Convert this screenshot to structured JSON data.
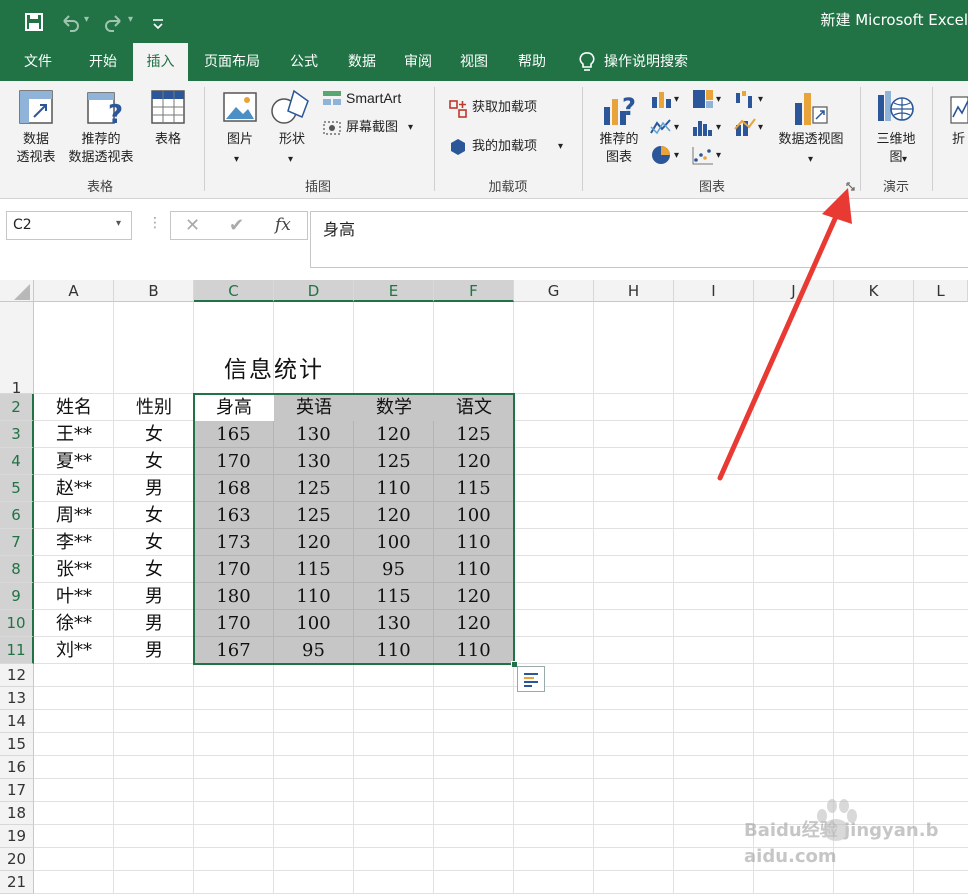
{
  "window": {
    "title": "新建 Microsoft Excel"
  },
  "menu": {
    "tabs": [
      "文件",
      "开始",
      "插入",
      "页面布局",
      "公式",
      "数据",
      "审阅",
      "视图",
      "帮助"
    ],
    "active_tab": "插入",
    "search_hint": "操作说明搜索"
  },
  "ribbon": {
    "groups": {
      "tables": "表格",
      "illustrations": "插图",
      "addins": "加载项",
      "charts": "图表",
      "tours": "演示"
    },
    "pivot_table": [
      "数据",
      "透视表"
    ],
    "recommended_pivot": [
      "推荐的",
      "数据透视表"
    ],
    "table": "表格",
    "picture": "图片",
    "shapes": "形状",
    "smartart": "SmartArt",
    "screenshot": "屏幕截图",
    "get_addins": "获取加载项",
    "my_addins": "我的加载项",
    "recommended_charts": [
      "推荐的",
      "图表"
    ],
    "pivot_chart": "数据透视图",
    "map_3d": [
      "三维地",
      "图"
    ],
    "line_partial": "折"
  },
  "formula_bar": {
    "name_box": "C2",
    "fx": "fx",
    "content": "身高"
  },
  "sheet": {
    "columns": [
      "A",
      "B",
      "C",
      "D",
      "E",
      "F",
      "G",
      "H",
      "I",
      "J",
      "K",
      "L"
    ],
    "rows": [
      "1",
      "2",
      "3",
      "4",
      "5",
      "6",
      "7",
      "8",
      "9",
      "10",
      "11",
      "12",
      "13",
      "14",
      "15",
      "16",
      "17",
      "18",
      "19",
      "20",
      "21"
    ],
    "title": "信息统计",
    "headers": [
      "姓名",
      "性别",
      "身高",
      "英语",
      "数学",
      "语文"
    ],
    "records": [
      [
        "王**",
        "女",
        "165",
        "130",
        "120",
        "125"
      ],
      [
        "夏**",
        "女",
        "170",
        "130",
        "125",
        "120"
      ],
      [
        "赵**",
        "男",
        "168",
        "125",
        "110",
        "115"
      ],
      [
        "周**",
        "女",
        "163",
        "125",
        "120",
        "100"
      ],
      [
        "李**",
        "女",
        "173",
        "120",
        "100",
        "110"
      ],
      [
        "张**",
        "女",
        "170",
        "115",
        "95",
        "110"
      ],
      [
        "叶**",
        "男",
        "180",
        "110",
        "115",
        "120"
      ],
      [
        "徐**",
        "男",
        "170",
        "100",
        "130",
        "120"
      ],
      [
        "刘**",
        "男",
        "167",
        "95",
        "110",
        "110"
      ]
    ]
  },
  "watermark": "Baidu经验 jingyan.baidu.com",
  "colors": {
    "excel_green": "#217346",
    "selection_fill": "#c6c6c6",
    "arrow_red": "#e83a32"
  }
}
